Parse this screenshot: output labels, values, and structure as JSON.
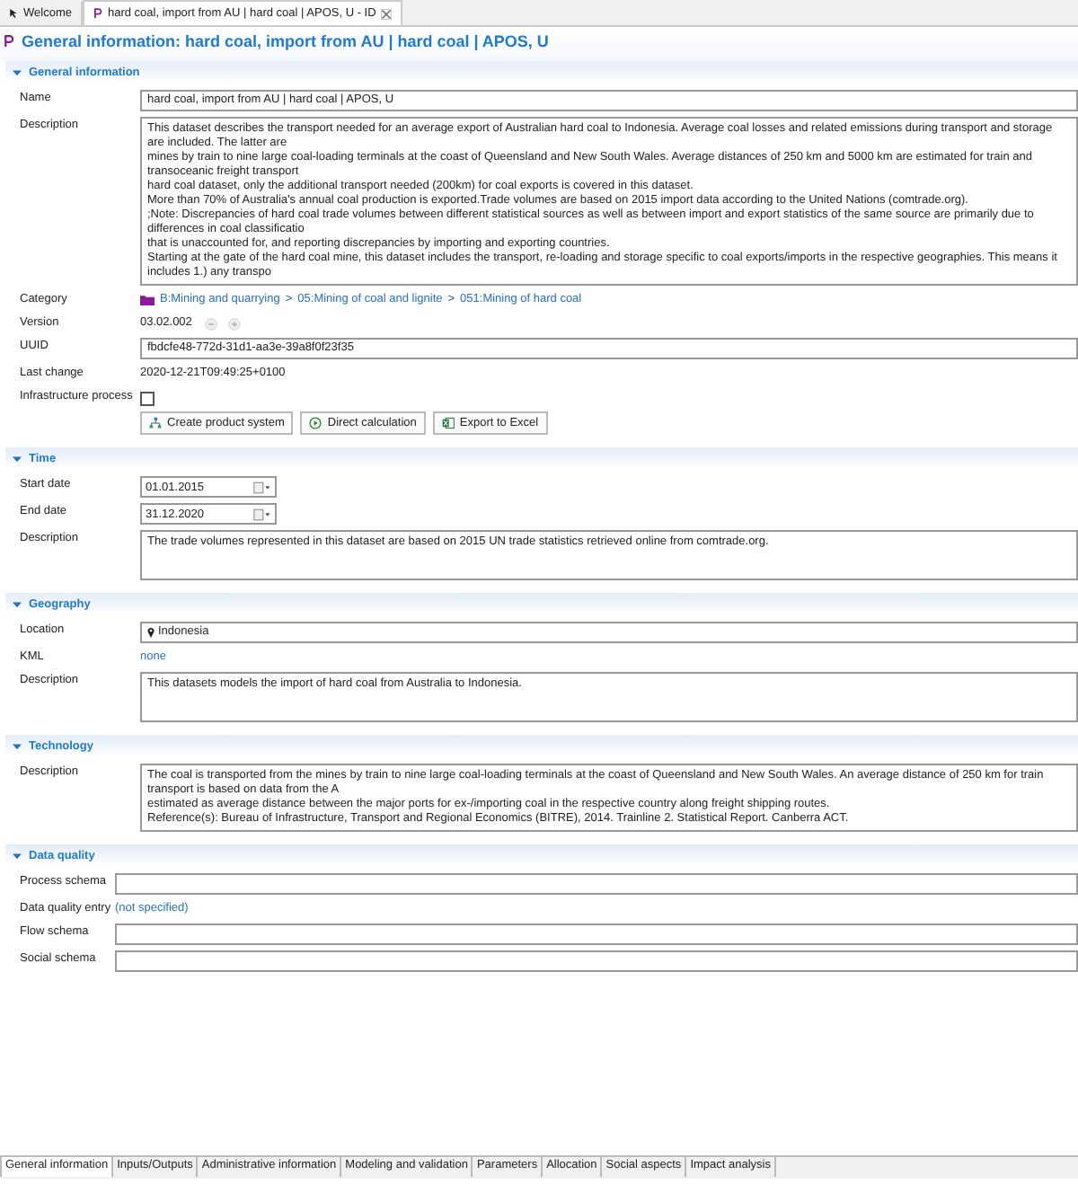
{
  "editor_tabs": [
    {
      "label": "Welcome",
      "selected": false,
      "kind": "welcome"
    },
    {
      "label": "hard coal, import from AU | hard coal | APOS, U - ID",
      "selected": true,
      "kind": "process"
    }
  ],
  "page_title": "General information: hard coal, import from AU | hard coal | APOS, U",
  "sections": [
    {
      "title": "General information",
      "expanded": true,
      "rows": [
        {
          "kind": "text",
          "label": "Name",
          "value": "hard coal, import from AU | hard coal | APOS, U"
        },
        {
          "kind": "area",
          "label": "Description",
          "lines": [
            "This dataset describes the transport needed for an average export of Australian hard coal to Indonesia. Average coal losses and related emissions during transport and storage are included. The latter are",
            "mines by train to nine large coal-loading terminals at the coast of Queensland and New South Wales. Average distances of 250 km and 5000 km are estimated for train and transoceanic freight transport",
            "hard coal dataset, only the additional transport needed (200km) for coal exports is covered in this dataset.",
            "More than 70% of Australia's annual coal production is exported.Trade volumes are based on 2015 import data according to the United Nations (comtrade.org).",
            ";Note: Discrepancies of hard coal trade volumes between different statistical sources as well as between import and export statistics of the same source are primarily due to differences in coal classificatio",
            "that is unaccounted for, and reporting discrepancies by importing and exporting countries.",
            "Starting at the gate of the hard coal mine, this dataset includes the transport, re-loading and storage specific to coal exports/imports in the respective geographies. This means it includes 1.) any transpo"
          ]
        },
        {
          "kind": "category",
          "label": "Category",
          "path": [
            "B:Mining and quarrying",
            "05:Mining of coal and lignite",
            "051:Mining of hard coal"
          ],
          "separator": ">"
        },
        {
          "kind": "version",
          "label": "Version",
          "value": "03.02.002"
        },
        {
          "kind": "text",
          "label": "UUID",
          "value": "fbdcfe48-772d-31d1-aa3e-39a8f0f23f35"
        },
        {
          "kind": "plain",
          "label": "Last change",
          "value": "2020-12-21T09:49:25+0100"
        },
        {
          "kind": "check",
          "label": "Infrastructure process",
          "checked": false
        },
        {
          "kind": "buttons",
          "buttons": [
            {
              "label": "Create product system",
              "kind": "system"
            },
            {
              "label": "Direct calculation",
              "kind": "calculate"
            },
            {
              "label": "Export to Excel",
              "kind": "excel"
            }
          ]
        }
      ]
    },
    {
      "title": "Time",
      "expanded": true,
      "rows": [
        {
          "kind": "date",
          "label": "Start date",
          "value": "01.01.2015"
        },
        {
          "kind": "date",
          "label": "End date",
          "value": "31.12.2020"
        },
        {
          "kind": "area",
          "label": "Description",
          "lines": [
            "The trade volumes represented in this dataset are based on 2015 UN trade statistics retrieved online from comtrade.org."
          ]
        }
      ]
    },
    {
      "title": "Geography",
      "expanded": true,
      "rows": [
        {
          "kind": "location",
          "label": "Location",
          "value": "Indonesia"
        },
        {
          "kind": "link",
          "label": "KML",
          "value": "none"
        },
        {
          "kind": "area",
          "label": "Description",
          "lines": [
            "This datasets models the import of hard coal from Australia to Indonesia."
          ]
        }
      ]
    },
    {
      "title": "Technology",
      "expanded": true,
      "rows": [
        {
          "kind": "area",
          "label": "Description",
          "lines": [
            "The coal is transported from the mines by train to nine large coal-loading terminals at the coast of Queensland and New South Wales. An average distance of 250 km for train transport is based on data from the A",
            "estimated as average distance between the major ports for ex-/importing coal in the respective country along freight shipping routes.",
            "Reference(s): Bureau of Infrastructure, Transport and Regional Economics (BITRE), 2014. Trainline 2. Statistical Report. Canberra ACT."
          ]
        }
      ]
    },
    {
      "title": "Data quality",
      "expanded": true,
      "rows": [
        {
          "kind": "text",
          "label": "Process schema"
        },
        {
          "kind": "link",
          "label": "Data quality entry",
          "value": "(not specified)"
        },
        {
          "kind": "text",
          "label": "Flow schema"
        },
        {
          "kind": "text",
          "label": "Social schema"
        }
      ]
    }
  ],
  "bottom_tabs": [
    {
      "label": "General information",
      "selected": true
    },
    {
      "label": "Inputs/Outputs",
      "selected": false
    },
    {
      "label": "Administrative information",
      "selected": false
    },
    {
      "label": "Modeling and validation",
      "selected": false
    },
    {
      "label": "Parameters",
      "selected": false
    },
    {
      "label": "Allocation",
      "selected": false
    },
    {
      "label": "Social aspects",
      "selected": false
    },
    {
      "label": "Impact analysis",
      "selected": false
    }
  ]
}
